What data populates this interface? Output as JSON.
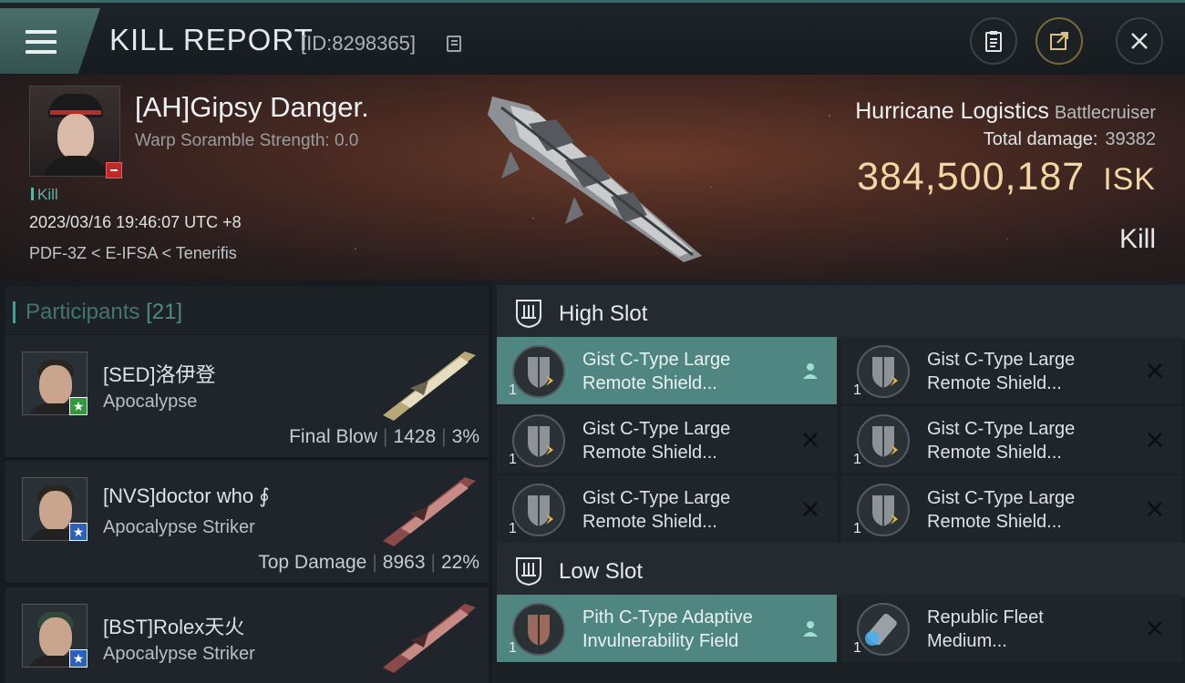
{
  "header": {
    "title": "KILL REPORT",
    "report_id": "[ID:8298365]"
  },
  "victim": {
    "name": "[AH]Gipsy Danger.",
    "scramble": "Warp Soramble Strength: 0.0",
    "tag": "Kill",
    "datetime": "2023/03/16 19:46:07 UTC +8",
    "location": "PDF-3Z < E-IFSA < Tenerifis",
    "ship": "Hurricane Logistics",
    "ship_class": "Battlecruiser",
    "total_damage_label": "Total damage:",
    "total_damage": "39382",
    "isk_value": "384,500,187",
    "isk_unit": "ISK",
    "result": "Kill"
  },
  "participants": {
    "label": "Participants",
    "count": "[21]",
    "rows": [
      {
        "name": "[SED]洛伊登",
        "ship": "Apocalypse",
        "role": "Final Blow",
        "damage": "1428",
        "percent": "3%",
        "badge": "★",
        "badge_color": "green"
      },
      {
        "name": "[NVS]doctor who ∮",
        "ship": "Apocalypse Striker",
        "role": "Top Damage",
        "damage": "8963",
        "percent": "22%",
        "badge": "★",
        "badge_color": "blue"
      },
      {
        "name": "[BST]Rolex天火",
        "ship": "Apocalypse Striker",
        "role": "",
        "damage": "",
        "percent": "",
        "badge": "★",
        "badge_color": "blue"
      }
    ]
  },
  "fitting": {
    "high_slot_label": "High Slot",
    "low_slot_label": "Low Slot",
    "high_slot": [
      {
        "name_line1": "Gist C-Type Large",
        "name_line2": "Remote Shield...",
        "qty": "1",
        "status": "person-icon",
        "selected": true
      },
      {
        "name_line1": "Gist C-Type Large",
        "name_line2": "Remote Shield...",
        "qty": "1",
        "status": "x-icon",
        "selected": false
      },
      {
        "name_line1": "Gist C-Type Large",
        "name_line2": "Remote Shield...",
        "qty": "1",
        "status": "x-icon",
        "selected": false
      },
      {
        "name_line1": "Gist C-Type Large",
        "name_line2": "Remote Shield...",
        "qty": "1",
        "status": "x-icon",
        "selected": false
      },
      {
        "name_line1": "Gist C-Type Large",
        "name_line2": "Remote Shield...",
        "qty": "1",
        "status": "x-icon",
        "selected": false
      },
      {
        "name_line1": "Gist C-Type Large",
        "name_line2": "Remote Shield...",
        "qty": "1",
        "status": "x-icon",
        "selected": false
      }
    ],
    "low_slot": [
      {
        "name_line1": "Pith C-Type Adaptive",
        "name_line2": "Invulnerability Field",
        "qty": "1",
        "status": "person-icon",
        "selected": true
      },
      {
        "name_line1": "Republic Fleet",
        "name_line2": "Medium...",
        "qty": "1",
        "status": "x-icon",
        "selected": false
      }
    ]
  },
  "colors": {
    "accent_teal": "#4f8681",
    "isk_gold": "#f3d7a3",
    "badge_green": "#2f9a3a",
    "badge_blue": "#2a5fc4",
    "negative_red": "#c0282a"
  }
}
